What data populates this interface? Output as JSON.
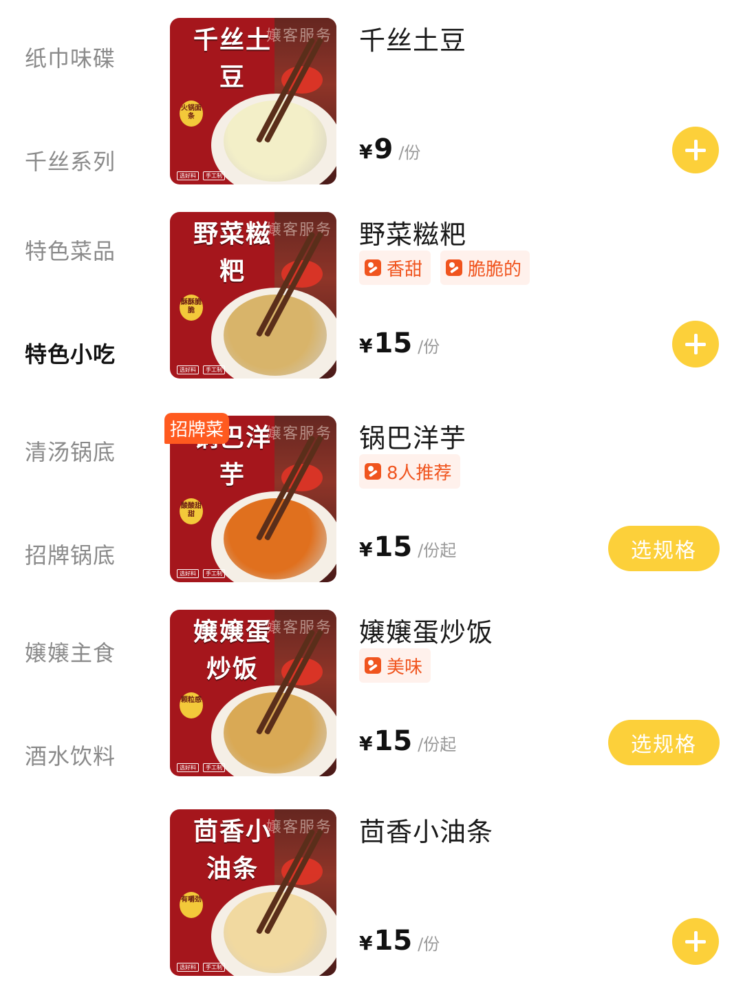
{
  "sidebar": {
    "categories": [
      {
        "label": "纸巾味碟",
        "active": false
      },
      {
        "label": "千丝系列",
        "active": false
      },
      {
        "label": "特色菜品",
        "active": false
      },
      {
        "label": "特色小吃",
        "active": true
      },
      {
        "label": "清汤锅底",
        "active": false
      },
      {
        "label": "招牌锅底",
        "active": false
      },
      {
        "label": "嬢嬢主食",
        "active": false
      },
      {
        "label": "酒水饮料",
        "active": false
      }
    ]
  },
  "items": [
    {
      "name": "千丝土豆",
      "image_title": "千丝土豆",
      "image_seal": "火锅面条",
      "tags": [],
      "price_symbol": "¥",
      "price": "9",
      "unit": "/份",
      "action": "plus",
      "food_color": "#f3efc8"
    },
    {
      "name": "野菜糍粑",
      "image_title": "野菜糍粑",
      "image_seal": "酥酥脆脆",
      "tags": [
        "香甜",
        "脆脆的"
      ],
      "price_symbol": "¥",
      "price": "15",
      "unit": "/份",
      "action": "plus",
      "food_color": "#d8b46a"
    },
    {
      "name": "锅巴洋芋",
      "image_title": "锅巴洋芋",
      "image_seal": "酸酸甜甜",
      "badge": "招牌菜",
      "tags": [
        "8人推荐"
      ],
      "price_symbol": "¥",
      "price": "15",
      "unit": "/份起",
      "action": "spec",
      "action_label": "选规格",
      "food_color": "#e0701e"
    },
    {
      "name": "嬢嬢蛋炒饭",
      "image_title": "嬢嬢蛋炒饭",
      "image_seal": "颗粒感",
      "tags": [
        "美味"
      ],
      "price_symbol": "¥",
      "price": "15",
      "unit": "/份起",
      "action": "spec",
      "action_label": "选规格",
      "food_color": "#d9a955"
    },
    {
      "name": "茴香小油条",
      "image_title": "茴香小油条",
      "image_seal": "有嚼劲",
      "tags": [],
      "price_symbol": "¥",
      "price": "15",
      "unit": "/份",
      "action": "plus",
      "food_color": "#f1d9a0"
    }
  ],
  "image_shop_text": "嬢客服务",
  "image_small_tags": [
    "选好料",
    "手工制"
  ],
  "colors": {
    "accent_yellow": "#fcd03a",
    "tag_orange": "#f0541e",
    "badge_orange": "#ff5a1f",
    "image_red": "#a5161c"
  }
}
